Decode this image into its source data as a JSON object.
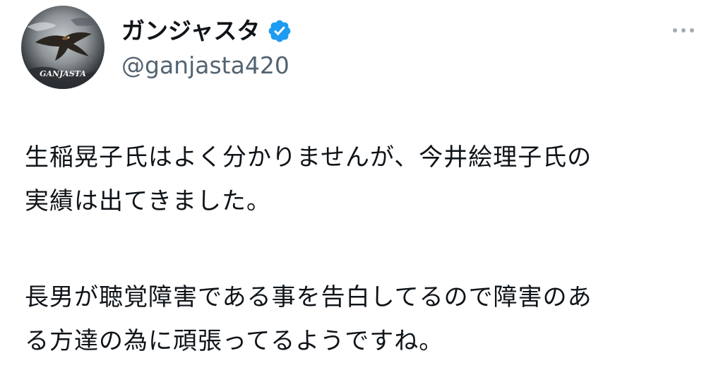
{
  "author": {
    "display_name": "ガンジャスタ",
    "handle": "@ganjasta420",
    "avatar_text": "GANJASTA",
    "verified": true,
    "verified_color": "#1d9bf0"
  },
  "menu": {
    "icon": "more-horizontal-icon"
  },
  "tweet": {
    "paragraph1": [
      "生稲晃子氏はよく分かりませんが、今井絵理子氏の",
      "実績は出てきました。"
    ],
    "paragraph2": [
      "長男が聴覚障害である事を告白してるので障害のあ",
      "る方達の為に頑張ってるようですね。"
    ]
  }
}
